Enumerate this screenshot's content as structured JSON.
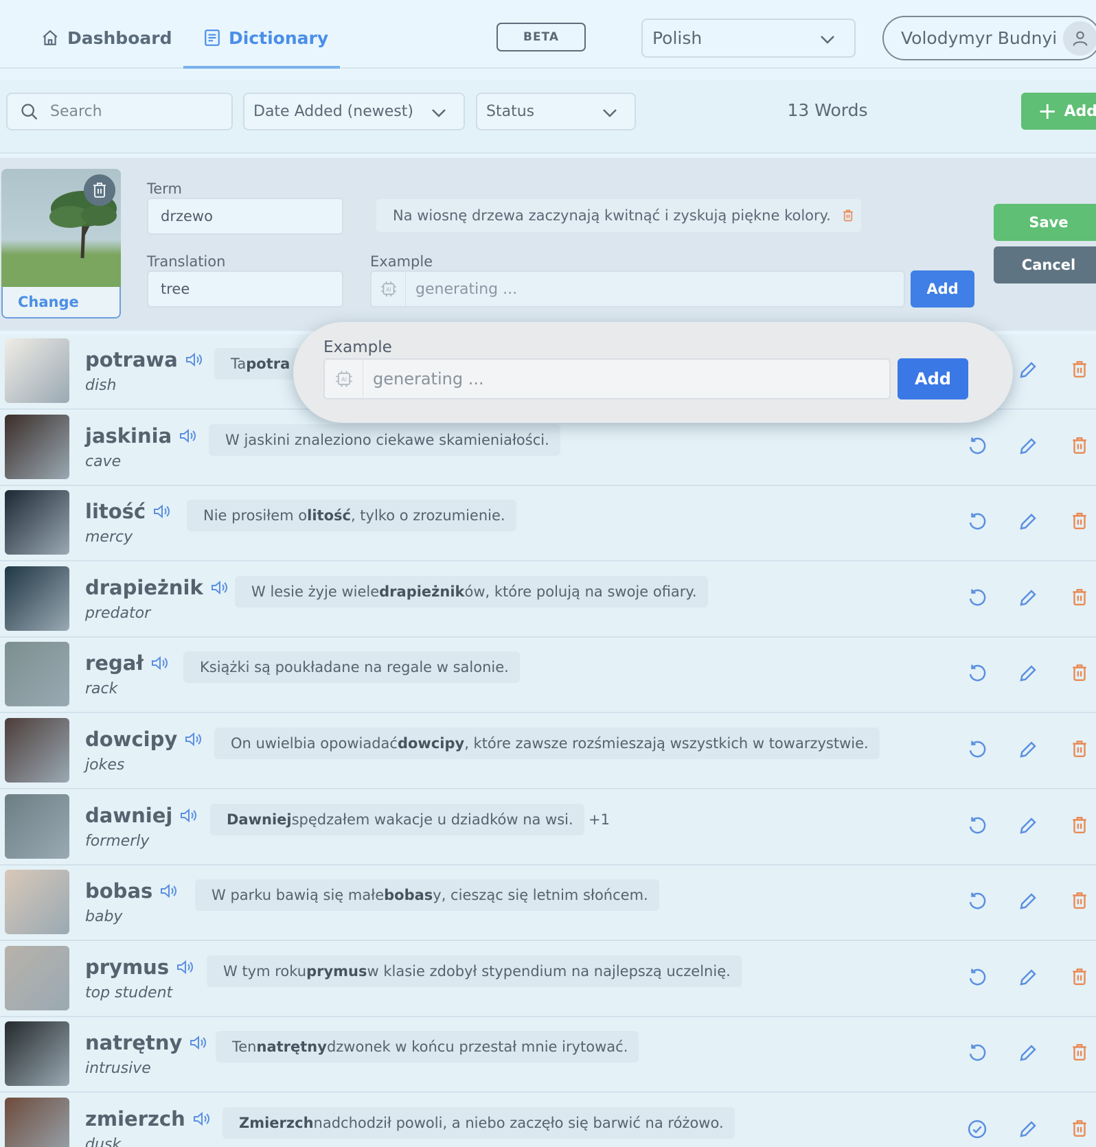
{
  "nav": {
    "dashboard": "Dashboard",
    "dictionary": "Dictionary",
    "beta": "BETA",
    "language": "Polish",
    "user": "Volodymyr Budnyi"
  },
  "filters": {
    "search_placeholder": "Search",
    "sort": "Date Added (newest)",
    "status": "Status",
    "count": "13 Words",
    "add": "Add"
  },
  "edit": {
    "term_label": "Term",
    "term_value": "drzewo",
    "translation_label": "Translation",
    "translation_value": "tree",
    "existing_example": "Na wiosnę drzewa zaczynają kwitnąć i zyskują piękne kolory.",
    "example_label": "Example",
    "example_placeholder": "generating ...",
    "add": "Add",
    "save": "Save",
    "cancel": "Cancel",
    "change": "Change"
  },
  "popup": {
    "label": "Example",
    "placeholder": "generating ...",
    "add": "Add"
  },
  "words": [
    {
      "term": "potrawa",
      "translation": "dish",
      "example": [
        [
          "Ta ",
          false
        ],
        [
          "potra",
          true
        ]
      ],
      "extra": "",
      "status": "reset",
      "thumb": "#f0ece6"
    },
    {
      "term": "jaskinia",
      "translation": "cave",
      "example": [
        [
          "W jaskini znaleziono ciekawe skamieniałości.",
          false
        ]
      ],
      "extra": "",
      "status": "reset",
      "thumb": "#3b2d29"
    },
    {
      "term": "litość",
      "translation": "mercy",
      "example": [
        [
          "Nie prosiłem o ",
          false
        ],
        [
          "litość",
          true
        ],
        [
          ", tylko o zrozumienie.",
          false
        ]
      ],
      "extra": "",
      "status": "reset",
      "thumb": "#1d2834"
    },
    {
      "term": "drapieżnik",
      "translation": "predator",
      "example": [
        [
          "W lesie żyje wiele ",
          false
        ],
        [
          "drapieżnik",
          true
        ],
        [
          "ów, które polują na swoje ofiary.",
          false
        ]
      ],
      "extra": "",
      "status": "reset",
      "thumb": "#1f3744"
    },
    {
      "term": "regał",
      "translation": "rack",
      "example": [
        [
          "Książki są poukładane na regale w salonie.",
          false
        ]
      ],
      "extra": "",
      "status": "reset",
      "thumb": "#7c8f8f"
    },
    {
      "term": "dowcipy",
      "translation": "jokes",
      "example": [
        [
          "On uwielbia opowiadać ",
          false
        ],
        [
          "dowcipy",
          true
        ],
        [
          ", które zawsze rozśmieszają wszystkich w towarzystwie.",
          false
        ]
      ],
      "extra": "",
      "status": "reset",
      "thumb": "#4d3d3a"
    },
    {
      "term": "dawniej",
      "translation": "formerly",
      "example": [
        [
          "Dawniej",
          true
        ],
        [
          " spędzałem wakacje u dziadków na wsi.",
          false
        ]
      ],
      "extra": "+1",
      "status": "reset",
      "thumb": "#6c7e84"
    },
    {
      "term": "bobas",
      "translation": "baby",
      "example": [
        [
          "W parku bawią się małe ",
          false
        ],
        [
          "bobas",
          true
        ],
        [
          "y, ciesząc się letnim słońcem.",
          false
        ]
      ],
      "extra": "",
      "status": "reset",
      "thumb": "#d8c8b8"
    },
    {
      "term": "prymus",
      "translation": "top student",
      "example": [
        [
          "W tym roku ",
          false
        ],
        [
          "prymus",
          true
        ],
        [
          " w klasie zdobył stypendium na najlepszą uczelnię.",
          false
        ]
      ],
      "extra": "",
      "status": "reset",
      "thumb": "#b8b2aa"
    },
    {
      "term": "natrętny",
      "translation": "intrusive",
      "example": [
        [
          "Ten ",
          false
        ],
        [
          "natrętny",
          true
        ],
        [
          " dzwonek w końcu przestał mnie irytować.",
          false
        ]
      ],
      "extra": "",
      "status": "reset",
      "thumb": "#242a2c"
    },
    {
      "term": "zmierzch",
      "translation": "dusk",
      "example": [
        [
          "Zmierzch",
          true
        ],
        [
          " nadchodził powoli, a niebo zaczęło się barwić na różowo.",
          false
        ]
      ],
      "extra": "",
      "status": "done",
      "thumb": "#6e4b3c"
    }
  ],
  "colors": {
    "accent": "#4a8ee8",
    "save": "#5fbf74",
    "cancel": "#5f7482",
    "danger": "#e98a56",
    "add": "#3a78e6"
  }
}
